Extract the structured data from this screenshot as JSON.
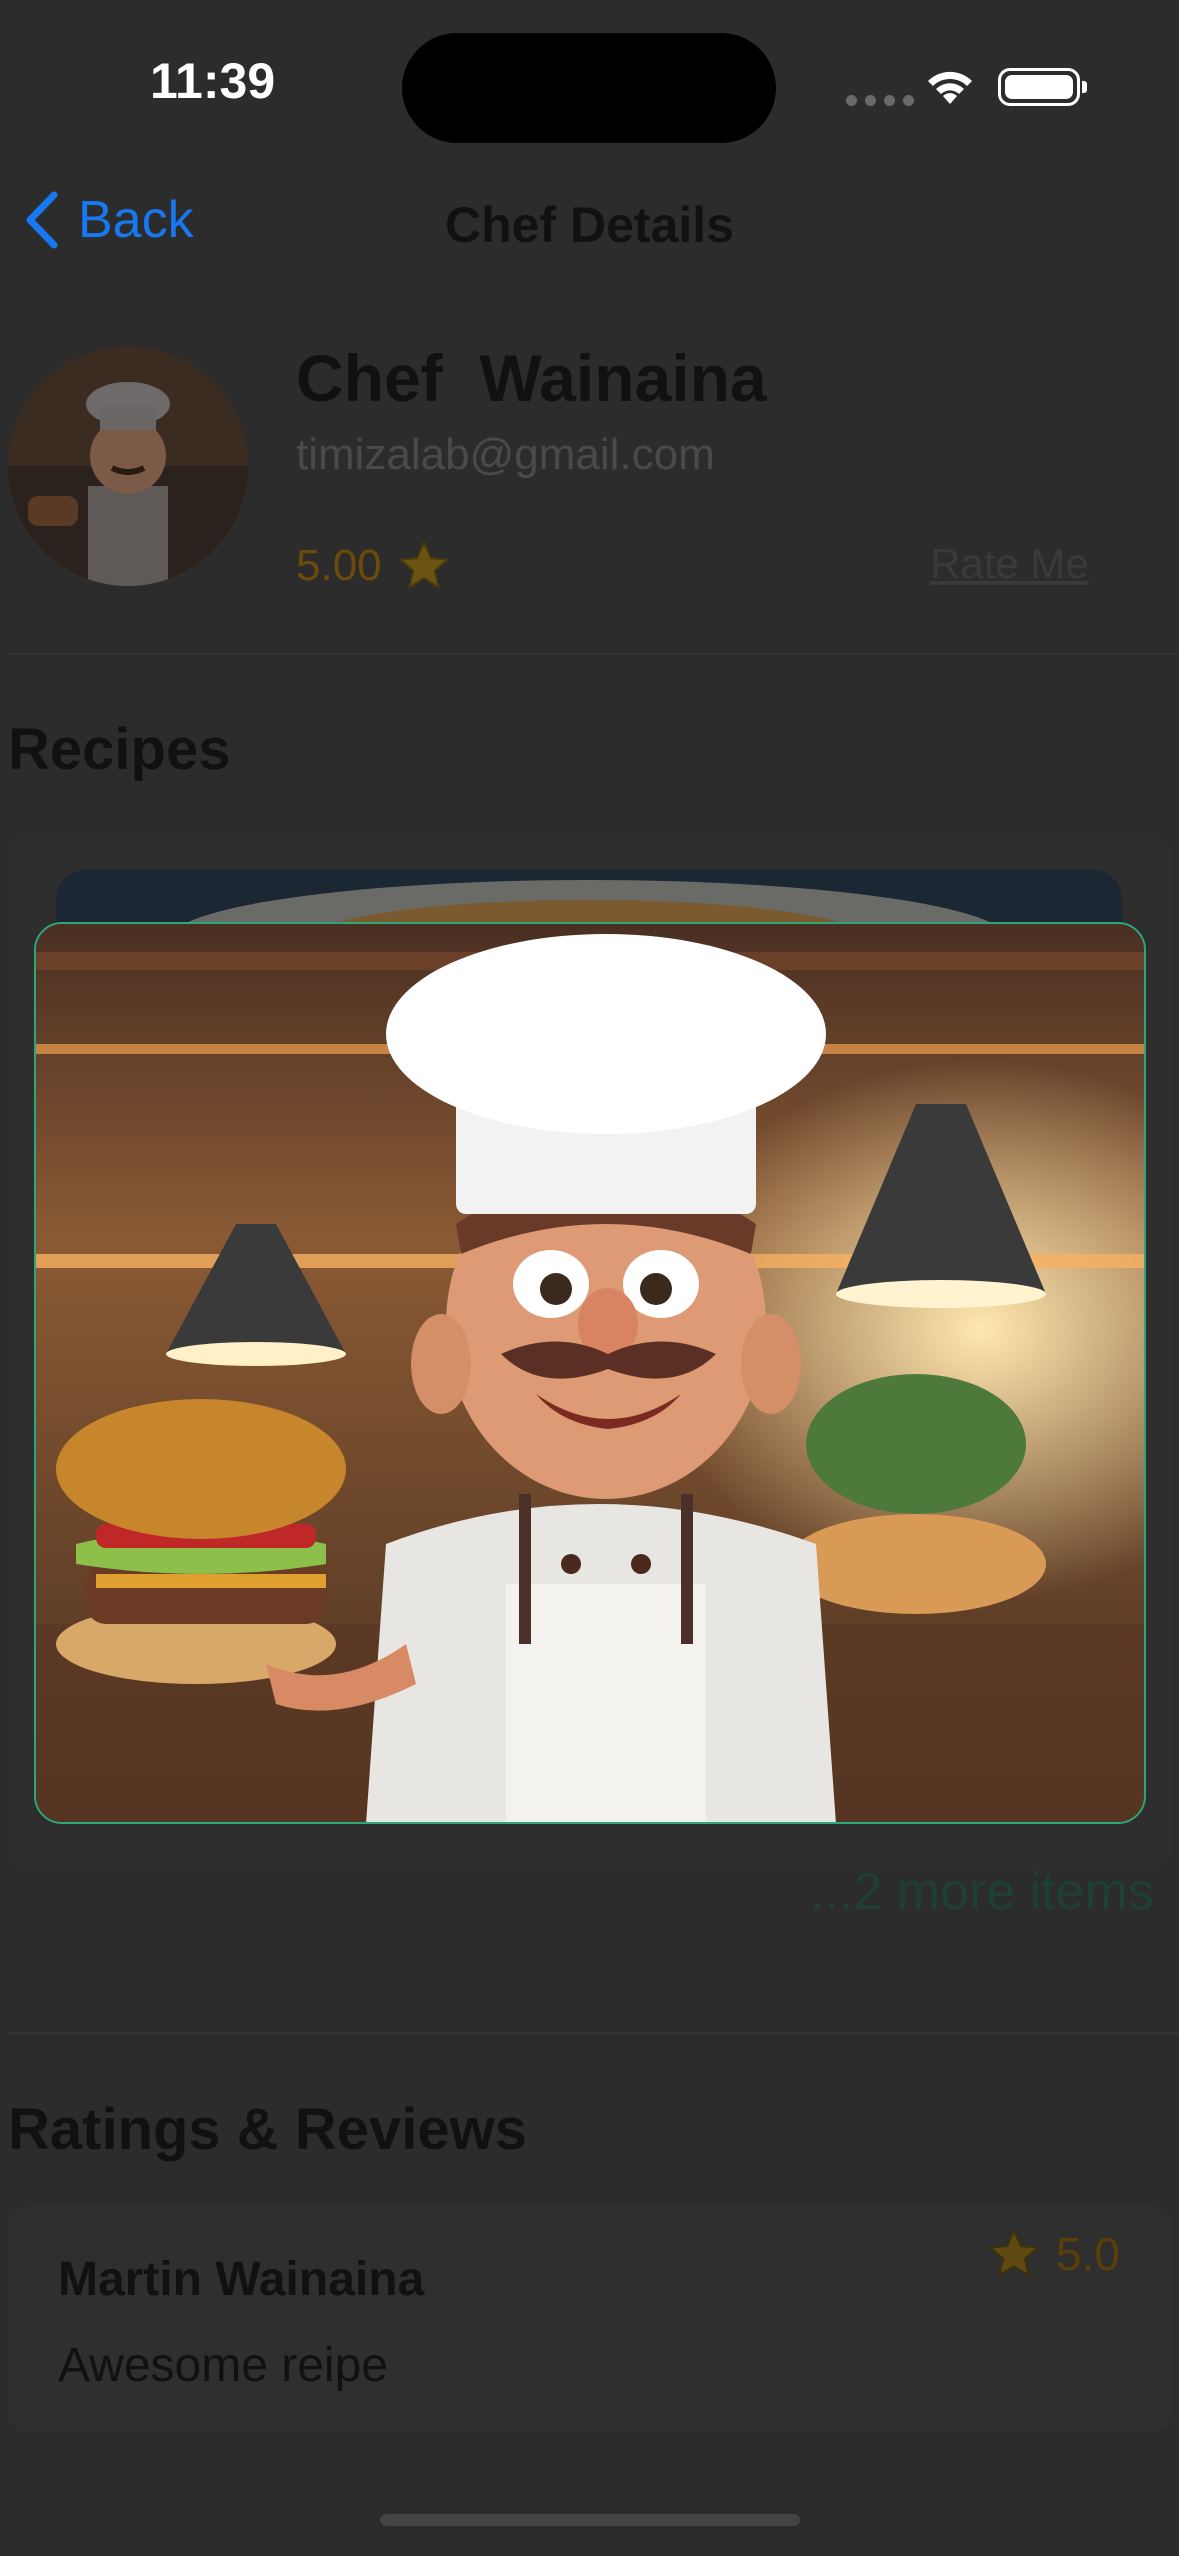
{
  "status_bar": {
    "time": "11:39"
  },
  "nav": {
    "back_label": "Back",
    "title": "Chef Details"
  },
  "chef": {
    "name": "Chef  Wainaina",
    "email": "timizalab@gmail.com",
    "rating": "5.00",
    "rate_label": "Rate Me"
  },
  "recipes": {
    "title": "Recipes",
    "more_items": "...2 more items"
  },
  "reviews": {
    "title": "Ratings & Reviews",
    "items": [
      {
        "name": "Martin Wainaina",
        "text": "Awesome reipe",
        "rating": "5.0"
      }
    ]
  },
  "colors": {
    "accent": "#1778f2",
    "card_border": "#2aa77b",
    "star": "#b8860b"
  }
}
